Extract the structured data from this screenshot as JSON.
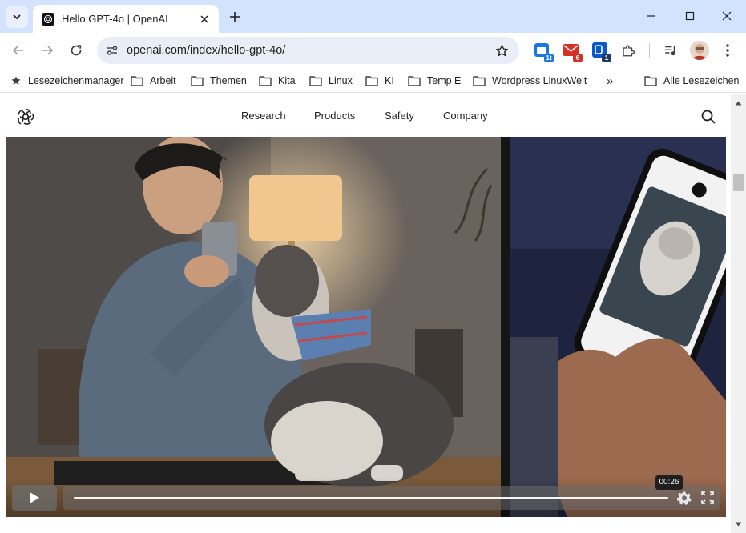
{
  "browser": {
    "tab": {
      "title": "Hello GPT-4o | OpenAI",
      "favicon": "openai-logo-icon"
    },
    "url": "openai.com/index/hello-gpt-4o/",
    "extensions": [
      {
        "name": "calendar-extension-icon",
        "badge": "1t",
        "color": "#1a73e8"
      },
      {
        "name": "mail-extension-icon",
        "badge": "6",
        "color": "#d93025"
      },
      {
        "name": "outlook-extension-icon",
        "badge": "1",
        "color": "#0b57d0"
      }
    ],
    "accent_color": "#d3e3fd"
  },
  "bookmarks": {
    "manager_label": "Lesezeichenmanager",
    "folders": [
      "Arbeit",
      "Themen",
      "Kita",
      "Linux",
      "KI",
      "Temp E",
      "Wordpress LinuxWelt"
    ],
    "overflow_glyph": "»",
    "all_label": "Alle Lesezeichen"
  },
  "site": {
    "nav": [
      "Research",
      "Products",
      "Safety",
      "Company"
    ]
  },
  "video": {
    "timestamp": "00:26",
    "progress_fraction": 0.0
  }
}
